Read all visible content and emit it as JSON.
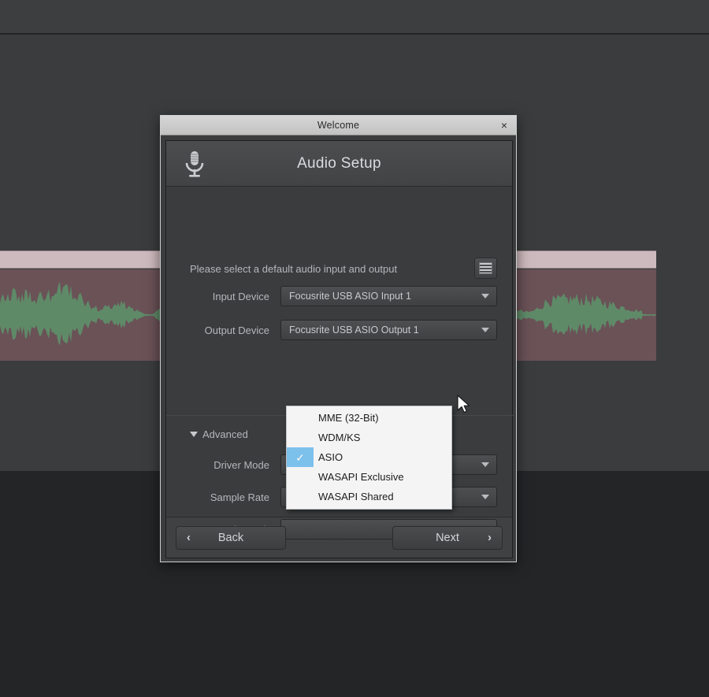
{
  "window": {
    "title": "Welcome",
    "close_label": "×"
  },
  "header": {
    "title": "Audio Setup",
    "icon": "microphone-icon"
  },
  "body": {
    "instruction": "Please select a default audio input and output",
    "menu_button_icon": "list-menu-icon",
    "fields": [
      {
        "label": "Input Device",
        "value": "Focusrite USB ASIO Input 1",
        "align": "left"
      },
      {
        "label": "Output Device",
        "value": "Focusrite USB ASIO Output 1",
        "align": "left"
      }
    ],
    "advanced": {
      "label": "Advanced",
      "expanded": true,
      "fields": [
        {
          "label": "Driver Mode",
          "value": "ASIO",
          "align": "center"
        },
        {
          "label": "Sample Rate",
          "value": "",
          "align": "left"
        },
        {
          "label": "Bit Depth",
          "value": "",
          "align": "left"
        }
      ]
    }
  },
  "dropdown": {
    "open": true,
    "selected": "ASIO",
    "highlight_color": "#7cc0ec",
    "options": [
      {
        "label": "MME (32-Bit)",
        "checked": false
      },
      {
        "label": "WDM/KS",
        "checked": false
      },
      {
        "label": "ASIO",
        "checked": true
      },
      {
        "label": "WASAPI Exclusive",
        "checked": false
      },
      {
        "label": "WASAPI Shared",
        "checked": false
      }
    ]
  },
  "footer": {
    "back_label": "Back",
    "back_chevron": "‹",
    "next_label": "Next",
    "next_chevron": "›"
  },
  "background": {
    "app": "daw-arrange-view",
    "clip_header_color": "#cdbabe",
    "clip_body_color": "#6b5358",
    "waveform_color": "#5f8a68"
  }
}
